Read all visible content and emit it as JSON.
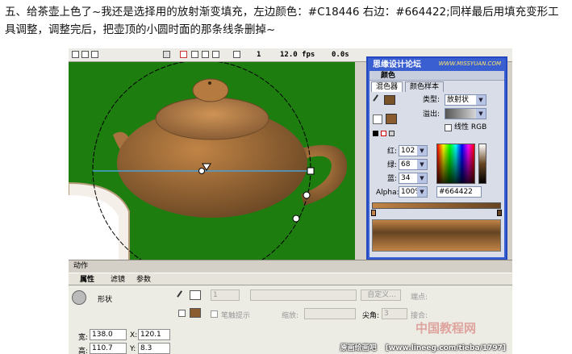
{
  "caption": {
    "line1": "五、给茶壶上色了~我还是选择用的放射渐变填充，左边颜色：#C18446 右边：#664422;同样最后用填充变形工",
    "line2": "具调整，调整完后，把壶顶的小圆时面的那条线条删掉~"
  },
  "timeline": {
    "frame": "1",
    "fps": "12.0 fps",
    "time": "0.0s"
  },
  "panel": {
    "title": "思缘设计论坛",
    "watermark": "WWW.MISSYUAN.COM",
    "section": "颜色",
    "tabs": [
      "混色器",
      "颜色样本"
    ],
    "type_label": "类型:",
    "type_value": "放射状",
    "overflow_label": "溢出:",
    "linear_rgb": "线性 RGB",
    "red_label": "红:",
    "red_value": "102",
    "green_label": "绿:",
    "green_value": "68",
    "blue_label": "蓝:",
    "blue_value": "34",
    "alpha_label": "Alpha:",
    "alpha_value": "100%",
    "hex_value": "#664422",
    "gradient_left": "#C18446",
    "gradient_right": "#664422"
  },
  "bottom": {
    "actions": "动作",
    "tabs": [
      "属性",
      "滤镜",
      "参数"
    ],
    "shape_label": "形状",
    "stroke_value": "1",
    "custom_button": "自定义...",
    "endpoint_label": "端点:",
    "stroke_hint": "笔触提示",
    "scale_label": "缩放:",
    "miter_label": "尖角:",
    "miter_value": "3",
    "join_label": "接合:",
    "w_label": "宽:",
    "w_value": "138.0",
    "x_label": "X:",
    "x_value": "120.1",
    "h_label": "高:",
    "h_value": "110.7",
    "y_label": "Y:",
    "y_value": "8.3"
  },
  "watermarks": {
    "source": "原画绘画吧",
    "url": "[www.lineeg.com/tieba/1797]",
    "site": "中国教程网"
  },
  "colors": {
    "stage_green": "#1d7d0f",
    "panel_blue": "#3a5fd0",
    "pot_light": "#c18446",
    "pot_dark": "#664422"
  }
}
